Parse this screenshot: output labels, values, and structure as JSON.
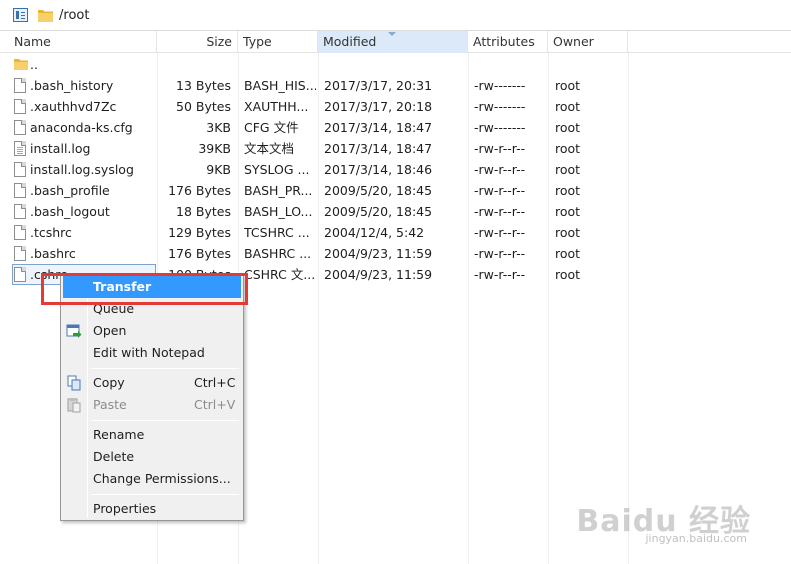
{
  "pathbar": {
    "path": "/root"
  },
  "columns": [
    {
      "key": "name",
      "label": "Name"
    },
    {
      "key": "size",
      "label": "Size"
    },
    {
      "key": "type",
      "label": "Type"
    },
    {
      "key": "modified",
      "label": "Modified"
    },
    {
      "key": "attributes",
      "label": "Attributes"
    },
    {
      "key": "owner",
      "label": "Owner"
    }
  ],
  "parent_row": {
    "name": ".."
  },
  "files": [
    {
      "name": ".bash_history",
      "size": "13 Bytes",
      "type": "BASH_HIS...",
      "modified": "2017/3/17, 20:31",
      "attributes": "-rw-------",
      "owner": "root"
    },
    {
      "name": ".xauthhvd7Zc",
      "size": "50 Bytes",
      "type": "XAUTHH...",
      "modified": "2017/3/17, 20:18",
      "attributes": "-rw-------",
      "owner": "root"
    },
    {
      "name": "anaconda-ks.cfg",
      "size": "3KB",
      "type": "CFG 文件",
      "modified": "2017/3/14, 18:47",
      "attributes": "-rw-------",
      "owner": "root"
    },
    {
      "name": "install.log",
      "size": "39KB",
      "type": "文本文档",
      "modified": "2017/3/14, 18:47",
      "attributes": "-rw-r--r--",
      "owner": "root"
    },
    {
      "name": "install.log.syslog",
      "size": "9KB",
      "type": "SYSLOG ...",
      "modified": "2017/3/14, 18:46",
      "attributes": "-rw-r--r--",
      "owner": "root"
    },
    {
      "name": ".bash_profile",
      "size": "176 Bytes",
      "type": "BASH_PR...",
      "modified": "2009/5/20, 18:45",
      "attributes": "-rw-r--r--",
      "owner": "root"
    },
    {
      "name": ".bash_logout",
      "size": "18 Bytes",
      "type": "BASH_LO...",
      "modified": "2009/5/20, 18:45",
      "attributes": "-rw-r--r--",
      "owner": "root"
    },
    {
      "name": ".tcshrc",
      "size": "129 Bytes",
      "type": "TCSHRC ...",
      "modified": "2004/12/4, 5:42",
      "attributes": "-rw-r--r--",
      "owner": "root"
    },
    {
      "name": ".bashrc",
      "size": "176 Bytes",
      "type": "BASHRC ...",
      "modified": "2004/9/23, 11:59",
      "attributes": "-rw-r--r--",
      "owner": "root"
    },
    {
      "name": ".cshrc",
      "size": "100 Bytes",
      "type": "CSHRC 文...",
      "modified": "2004/9/23, 11:59",
      "attributes": "-rw-r--r--",
      "owner": "root"
    }
  ],
  "context_menu": {
    "transfer": "Transfer",
    "queue": "Queue",
    "open": "Open",
    "edit_notepad": "Edit with Notepad",
    "copy": "Copy",
    "copy_shortcut": "Ctrl+C",
    "paste": "Paste",
    "paste_shortcut": "Ctrl+V",
    "rename": "Rename",
    "delete": "Delete",
    "change_permissions": "Change Permissions...",
    "properties": "Properties"
  },
  "watermark": {
    "brand": "Baidu 经验",
    "url": "jingyan.baidu.com"
  },
  "colors": {
    "highlight": "#3399ff",
    "annotation_box": "#e53935",
    "folder": "#f2c14e"
  }
}
